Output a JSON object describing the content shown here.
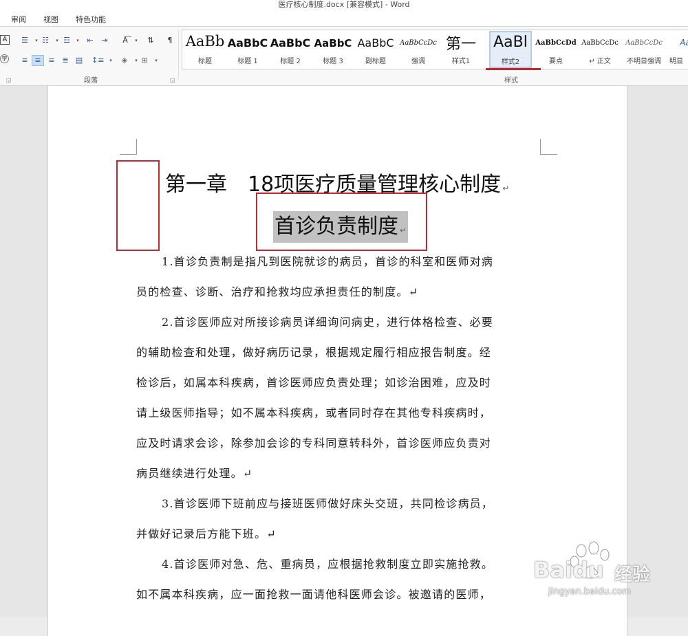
{
  "window": {
    "title": "医疗核心制度.docx [兼容模式] - Word"
  },
  "tabs": [
    "审阅",
    "视图",
    "特色功能"
  ],
  "ribbon": {
    "paragraph_group_label": "段落",
    "styles_group_label": "样式",
    "styles": [
      {
        "sample": "AaBb",
        "name": "标题"
      },
      {
        "sample": "AaBbC",
        "name": "标题 1"
      },
      {
        "sample": "AaBbC",
        "name": "标题 2"
      },
      {
        "sample": "AaBbC",
        "name": "标题 3"
      },
      {
        "sample": "AaBbC",
        "name": "副标题"
      },
      {
        "sample": "AaBbCcDc",
        "name": "强调"
      },
      {
        "sample": "第一",
        "name": "样式1"
      },
      {
        "sample": "AaBl",
        "name": "样式2",
        "selected": true
      },
      {
        "sample": "AaBbCcDd",
        "name": "要点"
      },
      {
        "sample": "AaBbCcDc",
        "name": "↵ 正文"
      },
      {
        "sample": "AaBbCcDc",
        "name": "不明显强调"
      },
      {
        "sample": "AaB",
        "name": "明显"
      }
    ],
    "icons": [
      "text-box-icon",
      "phonetic-guide-icon",
      "bullets-icon",
      "numbering-icon",
      "multilevel-list-icon",
      "decrease-indent-icon",
      "increase-indent-icon",
      "chinese-layout-icon",
      "sort-icon",
      "align-left-icon",
      "center-icon",
      "align-right-icon",
      "justify-icon",
      "distributed-icon",
      "line-spacing-icon",
      "shading-icon",
      "borders-icon"
    ]
  },
  "document": {
    "heading1": "第一章　18项医疗质量管理核心制度",
    "heading2": "首诊负责制度",
    "paragraph_mark": "↵",
    "lines": [
      {
        "text": "1.首诊负责制是指凡到医院就诊的病员，首诊的科室和医师对病",
        "indent": true
      },
      {
        "text": "员的检查、诊断、治疗和抢救均应承担责任的制度。↵",
        "indent": false
      },
      {
        "text": "2.首诊医师应对所接诊病员详细询问病史，进行体格检查、必要",
        "indent": true
      },
      {
        "text": "的辅助检查和处理，做好病历记录，根据规定履行相应报告制度。经",
        "indent": false
      },
      {
        "text": "检诊后，如属本科疾病，首诊医师应负责处理；如诊治困难，应及时",
        "indent": false
      },
      {
        "text": "请上级医师指导；如不属本科疾病，或者同时存在其他专科疾病时，",
        "indent": false
      },
      {
        "text": "应及时请求会诊，除参加会诊的专科同意转科外，首诊医师应负责对",
        "indent": false
      },
      {
        "text": "病员继续进行处理。↵",
        "indent": false
      },
      {
        "text": "3.首诊医师下班前应与接班医师做好床头交班，共同检诊病员，",
        "indent": true
      },
      {
        "text": "并做好记录后方能下班。↵",
        "indent": false
      },
      {
        "text": "4.首诊医师对急、危、重病员，应根据抢救制度立即实施抢救。",
        "indent": true
      },
      {
        "text": "如不属本科疾病，应一面抢救一面请他科医师会诊。被邀请的医师，",
        "indent": false
      }
    ]
  },
  "watermark": {
    "brand": "Baidu",
    "cn": "经验",
    "url": "jingyan.baidu.com"
  },
  "colors": {
    "annotation_red": "#c0282e",
    "highlight_gray": "#c1c1c1",
    "ribbon_bg": "#f8f8f8",
    "page_bg": "#ffffff"
  }
}
